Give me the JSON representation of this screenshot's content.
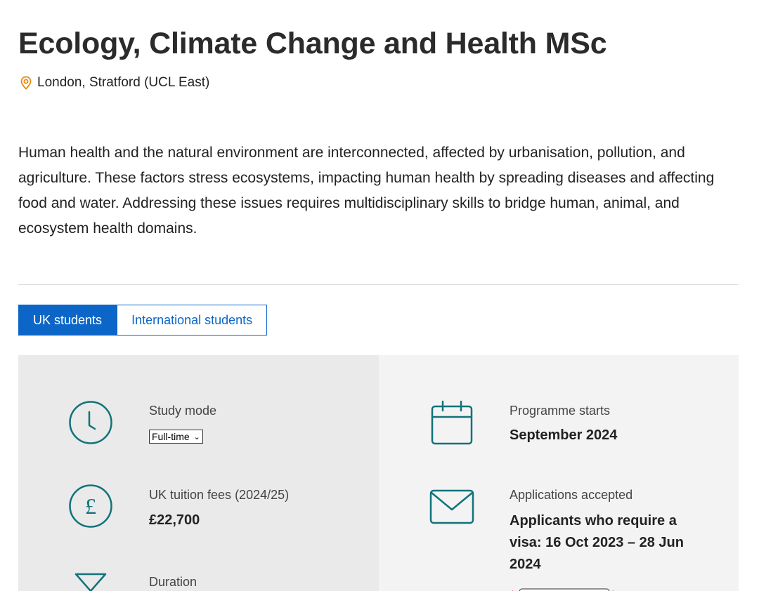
{
  "page": {
    "title": "Ecology, Climate Change and Health MSc",
    "location": "London, Stratford (UCL East)"
  },
  "intro": "Human health and the natural environment are interconnected, affected by urbanisation, pollution, and agriculture. These factors stress ecosystems, impacting human health by spreading diseases and affecting food and water. Addressing these issues requires multidisciplinary skills to bridge human, animal, and ecosystem health domains.",
  "tabs": [
    {
      "label": "UK students",
      "active": true
    },
    {
      "label": "International students",
      "active": false
    }
  ],
  "details": {
    "study_mode": {
      "label": "Study mode",
      "selected": "Full-time"
    },
    "fees": {
      "label": "UK tuition fees (2024/25)",
      "value": "£22,700"
    },
    "duration": {
      "label": "Duration"
    },
    "start": {
      "label": "Programme starts",
      "value": "September 2024"
    },
    "applications": {
      "label": "Applications accepted",
      "value": "Applicants who require a visa: 16 Oct 2023 – 28 Jun 2024"
    }
  },
  "colors": {
    "accent_blue": "#0b66c7",
    "icon_teal": "#12727a",
    "location_orange": "#e58a0b"
  },
  "icons": [
    "location-pin-icon",
    "clock-icon",
    "pound-icon",
    "hourglass-icon",
    "calendar-icon",
    "envelope-icon"
  ]
}
